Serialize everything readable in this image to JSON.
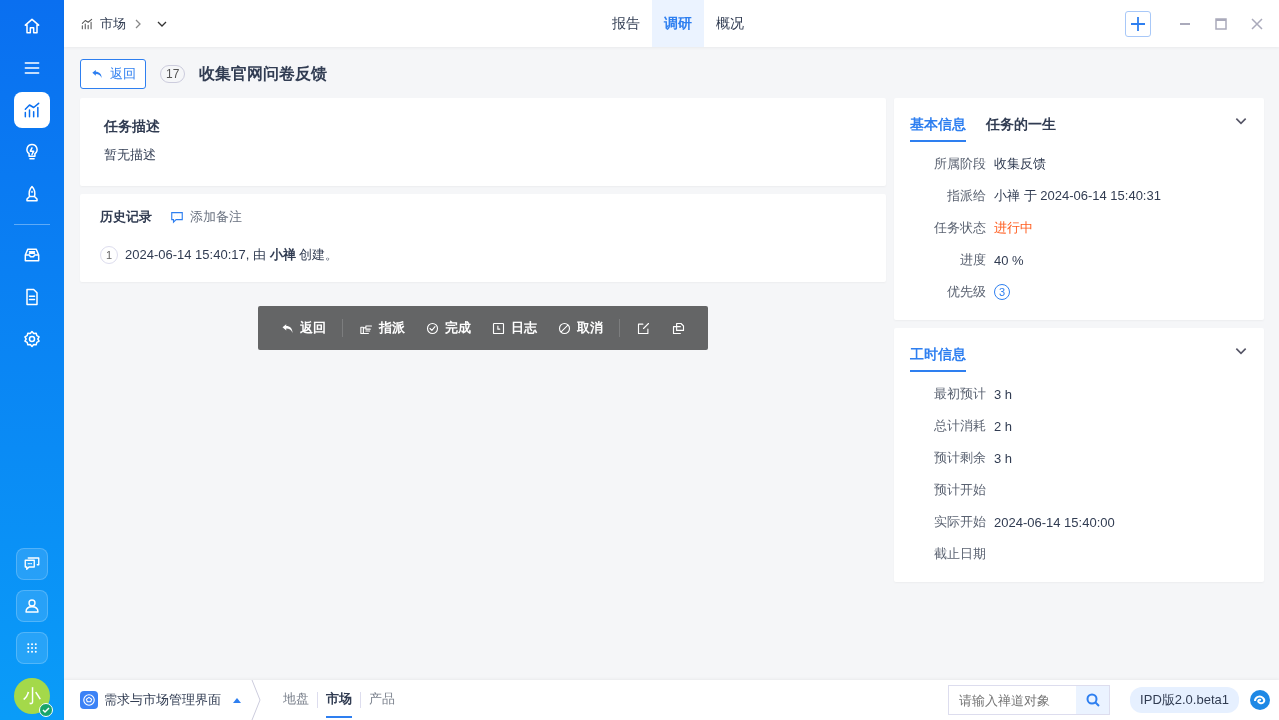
{
  "sidebar": {
    "nav": [
      {
        "kind": "home",
        "selected": false
      },
      {
        "kind": "menu",
        "selected": false
      },
      {
        "kind": "chart",
        "selected": true
      },
      {
        "kind": "bulb",
        "selected": false
      },
      {
        "kind": "rocket",
        "selected": false
      }
    ],
    "nav2": [
      {
        "kind": "inbox",
        "selected": false
      },
      {
        "kind": "document",
        "selected": false
      },
      {
        "kind": "gear",
        "selected": false
      }
    ],
    "bottom": [
      {
        "kind": "chat"
      },
      {
        "kind": "user"
      },
      {
        "kind": "grid"
      }
    ],
    "avatar": {
      "initial": "小",
      "online": true
    }
  },
  "header": {
    "breadcrumb": "市场",
    "tabs": [
      {
        "label": "报告",
        "selected": false
      },
      {
        "label": "调研",
        "selected": true
      },
      {
        "label": "概况",
        "selected": false
      }
    ]
  },
  "page": {
    "back": "返回",
    "id": "17",
    "title": "收集官网问卷反馈"
  },
  "description": {
    "heading": "任务描述",
    "text": "暂无描述"
  },
  "history": {
    "heading": "历史记录",
    "add_note": "添加备注",
    "entries": [
      {
        "index": "1",
        "text": "2024-06-14 15:40:17, 由 **小禅** 创建。"
      }
    ]
  },
  "toolbar": [
    {
      "kind": "back",
      "label": "返回"
    },
    {
      "kind": "separator"
    },
    {
      "kind": "assign",
      "label": "指派"
    },
    {
      "kind": "done",
      "label": "完成"
    },
    {
      "kind": "log",
      "label": "日志"
    },
    {
      "kind": "cancel",
      "label": "取消"
    },
    {
      "kind": "separator"
    },
    {
      "kind": "edit"
    },
    {
      "kind": "copy"
    }
  ],
  "basic_info": {
    "tabs": [
      {
        "label": "基本信息",
        "selected": true
      },
      {
        "label": "任务的一生",
        "selected": false
      }
    ],
    "fields": [
      {
        "label": "所属阶段",
        "value": "收集反馈",
        "kind": "text"
      },
      {
        "label": "指派给",
        "value": "小禅 于 2024-06-14 15:40:31",
        "kind": "text"
      },
      {
        "label": "任务状态",
        "value": "进行中",
        "kind": "status"
      },
      {
        "label": "进度",
        "value": "40 %",
        "kind": "text"
      },
      {
        "label": "优先级",
        "value": "3",
        "kind": "priority"
      }
    ]
  },
  "effort": {
    "tabs": [
      {
        "label": "工时信息",
        "selected": true
      }
    ],
    "fields": [
      {
        "label": "最初预计",
        "value": "3 h"
      },
      {
        "label": "总计消耗",
        "value": "2 h"
      },
      {
        "label": "预计剩余",
        "value": "3 h"
      },
      {
        "label": "预计开始"
      },
      {
        "label": "实际开始",
        "value": "2024-06-14 15:40:00"
      },
      {
        "label": "截止日期"
      }
    ]
  },
  "footer": {
    "app": "需求与市场管理界面",
    "nav": [
      {
        "label": "地盘",
        "selected": false
      },
      {
        "label": "市场",
        "selected": true
      },
      {
        "label": "产品",
        "selected": false
      }
    ],
    "search": {
      "placeholder": "请输入禅道对象"
    },
    "version": "IPD版2.0.beta1"
  }
}
